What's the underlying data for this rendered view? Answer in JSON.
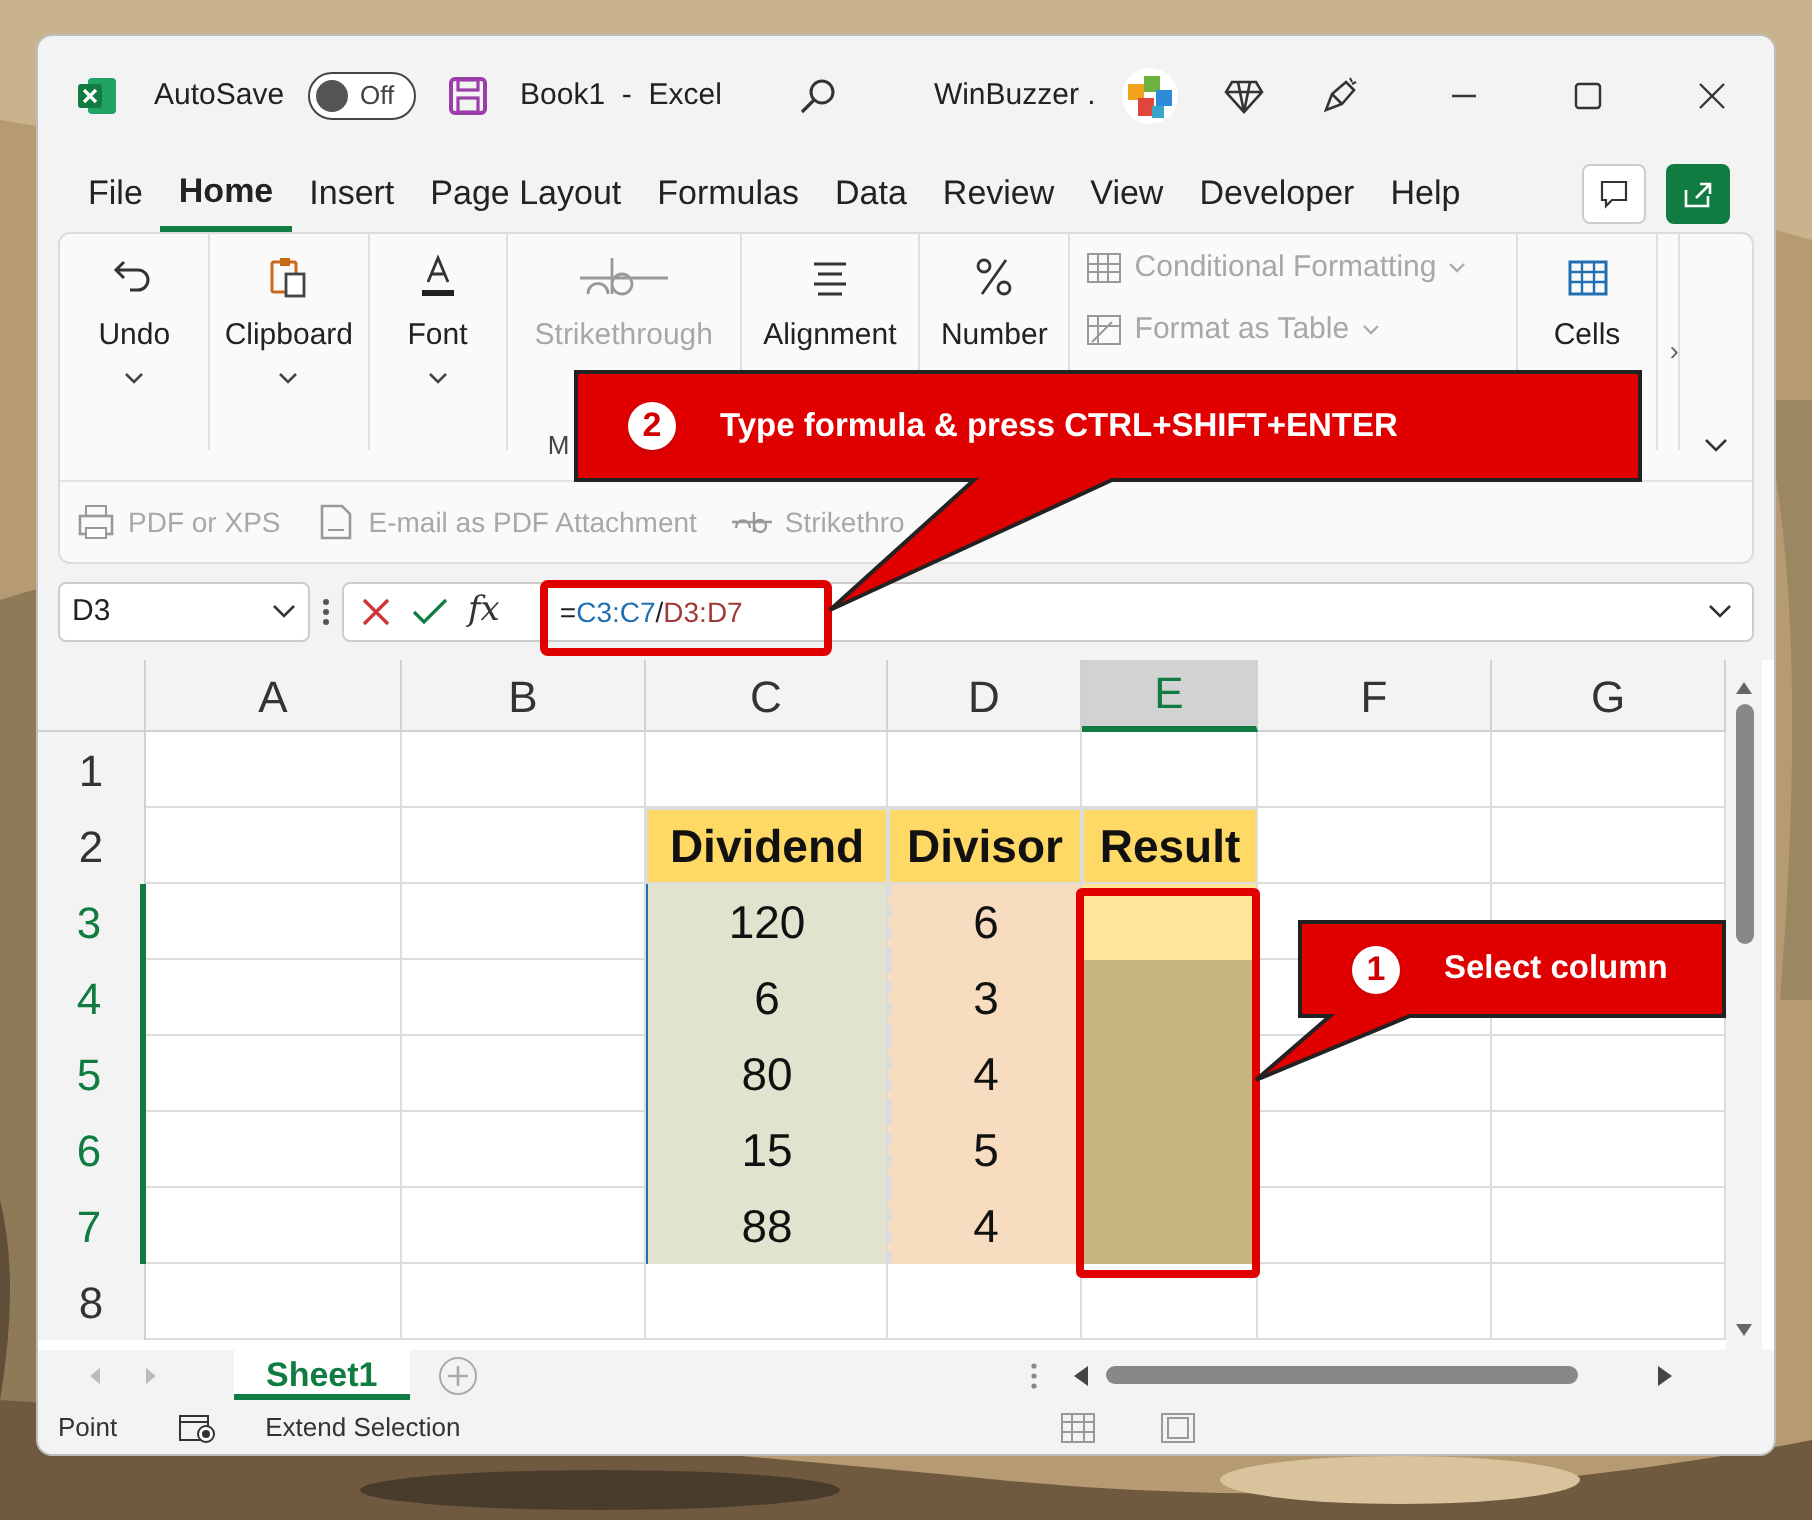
{
  "title_bar": {
    "autosave_label": "AutoSave",
    "autosave_on": false,
    "autosave_state": "Off",
    "document_title": "Book1  -  Excel",
    "account_name": "WinBuzzer ."
  },
  "menu_tabs": [
    {
      "label": "File",
      "selected": false
    },
    {
      "label": "Home",
      "selected": true
    },
    {
      "label": "Insert",
      "selected": false
    },
    {
      "label": "Page Layout",
      "selected": false
    },
    {
      "label": "Formulas",
      "selected": false
    },
    {
      "label": "Data",
      "selected": false
    },
    {
      "label": "Review",
      "selected": false
    },
    {
      "label": "View",
      "selected": false
    },
    {
      "label": "Developer",
      "selected": false
    },
    {
      "label": "Help",
      "selected": false
    }
  ],
  "ribbon": {
    "groups": [
      {
        "kind": "big",
        "label": "Undo",
        "disabled": false
      },
      {
        "kind": "big",
        "label": "Clipboard",
        "disabled": false
      },
      {
        "kind": "big",
        "label": "Font",
        "disabled": false
      },
      {
        "kind": "big",
        "label": "Strikethrough",
        "disabled": true,
        "caption": "M"
      },
      {
        "kind": "big",
        "label": "Alignment",
        "disabled": false
      },
      {
        "kind": "big",
        "label": "Number",
        "disabled": false
      },
      {
        "kind": "stack",
        "items": [
          {
            "label": "Conditional Formatting",
            "disabled": true
          },
          {
            "label": "Format as Table",
            "disabled": true
          }
        ]
      },
      {
        "kind": "big",
        "label": "Cells",
        "disabled": false
      }
    ],
    "more": "›"
  },
  "quick_access": [
    {
      "label": "PDF or XPS",
      "disabled": true
    },
    {
      "label": "E-mail as PDF Attachment",
      "disabled": true
    },
    {
      "label": "Strikethro",
      "disabled": true
    }
  ],
  "formula_bar": {
    "name_box": "D3",
    "fx": "fx",
    "formula": [
      {
        "text": "=",
        "color": "#222222"
      },
      {
        "text": "C3:C7",
        "color": "#1f6fb2"
      },
      {
        "text": "/",
        "color": "#222222"
      },
      {
        "text": "D3:D7",
        "color": "#a33a3a"
      }
    ]
  },
  "grid": {
    "columns": [
      {
        "label": "A",
        "selected": false
      },
      {
        "label": "B",
        "selected": false
      },
      {
        "label": "C",
        "selected": false
      },
      {
        "label": "D",
        "selected": false
      },
      {
        "label": "E",
        "selected": true
      },
      {
        "label": "F",
        "selected": false
      },
      {
        "label": "G",
        "selected": false
      }
    ],
    "rows": [
      {
        "label": "1",
        "selected": false
      },
      {
        "label": "2",
        "selected": false
      },
      {
        "label": "3",
        "selected": true
      },
      {
        "label": "4",
        "selected": true
      },
      {
        "label": "5",
        "selected": true
      },
      {
        "label": "6",
        "selected": true
      },
      {
        "label": "7",
        "selected": true
      },
      {
        "label": "8",
        "selected": false
      }
    ],
    "table": {
      "headings": [
        "Dividend",
        "Divisor",
        "Result"
      ],
      "rows": [
        {
          "dividend": "120",
          "divisor": "6",
          "active": true
        },
        {
          "dividend": "6",
          "divisor": "3",
          "active": false
        },
        {
          "dividend": "80",
          "divisor": "4",
          "active": false
        },
        {
          "dividend": "15",
          "divisor": "5",
          "active": false
        },
        {
          "dividend": "88",
          "divisor": "4",
          "active": false
        }
      ]
    }
  },
  "sheet_tabs": [
    {
      "label": "Sheet1",
      "selected": true
    }
  ],
  "status_bar": {
    "items": [
      "Point",
      "Extend Selection"
    ]
  },
  "callouts": [
    {
      "number": "2",
      "text": "Type formula & press CTRL+SHIFT+ENTER"
    },
    {
      "number": "1",
      "text": "Select column"
    }
  ]
}
